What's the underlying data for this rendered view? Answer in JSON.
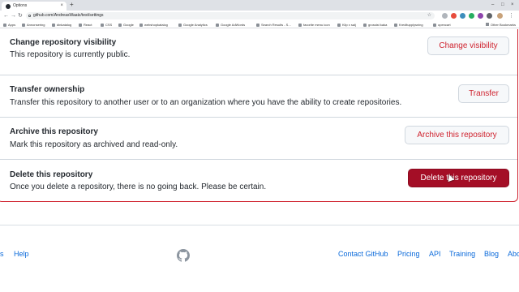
{
  "browser": {
    "tab_title": "Options",
    "tab_close": "×",
    "new_tab": "+",
    "url": "github.com/AndreasWaatz/test/settings",
    "bookmarks": [
      "Apps",
      "Annonsering",
      "dinkatalog",
      "React",
      "CSS",
      "Google",
      "webshopkatalog",
      "Google Analytics",
      "Google AdWords",
      "Search Results - S...",
      "favorite menu icon",
      "Klip x salj",
      "grossist kaka",
      "Kreditupplysning",
      "opencart"
    ],
    "other_bookmarks": "Other Bookmarks"
  },
  "danger_zone": {
    "rows": [
      {
        "title": "Change repository visibility",
        "description": "This repository is currently public.",
        "button": "Change visibility"
      },
      {
        "title": "Transfer ownership",
        "description": "Transfer this repository to another user or to an organization where you have the ability to create repositories.",
        "button": "Transfer"
      },
      {
        "title": "Archive this repository",
        "description": "Mark this repository as archived and read-only.",
        "button": "Archive this repository"
      },
      {
        "title": "Delete this repository",
        "description": "Once you delete a repository, there is no going back. Please be certain.",
        "button": "Delete this repository"
      }
    ]
  },
  "footer": {
    "left_links": [
      "s",
      "Help"
    ],
    "right_links": [
      "Contact GitHub",
      "Pricing",
      "API",
      "Training",
      "Blog",
      "Abo"
    ]
  },
  "colors": {
    "danger_border": "#cf222e",
    "danger_button": "#a40e26",
    "link": "#0969da"
  }
}
